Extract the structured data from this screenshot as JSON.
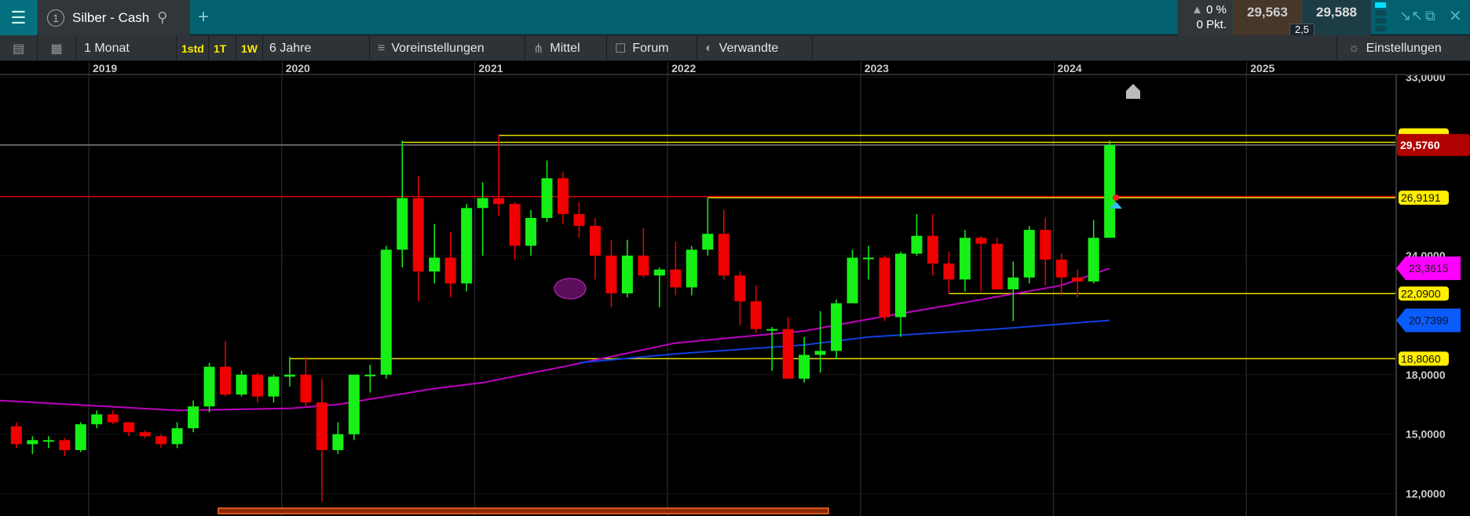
{
  "topbar": {
    "menu_icon": "hamburger-icon",
    "tab": {
      "number": "1",
      "title": "Silber - Cash",
      "search_icon": "magnifier-icon"
    },
    "add_tab_icon": "plus-icon",
    "change_percent": "0 %",
    "change_points": "0 Pkt.",
    "bid": "29,563",
    "ask": "29,588",
    "spread": "2,5",
    "colors": {
      "bar": "#02606f",
      "bid_bg": "#463728",
      "ask_bg": "#1c3d45"
    }
  },
  "toolbar": {
    "interval": "1 Monat",
    "quick": [
      "1std",
      "1T",
      "1W"
    ],
    "range": "6 Jahre",
    "presets": "Voreinstellungen",
    "indicator": "Mittel",
    "forum": "Forum",
    "related": "Verwandte",
    "settings": "Einstellungen"
  },
  "chart_data": {
    "type": "candlestick",
    "x_ticks": [
      "2019",
      "2020",
      "2021",
      "2022",
      "2023",
      "2024",
      "2025"
    ],
    "y_ticks": [
      "33,0000",
      "24,0000",
      "18,0000",
      "15,0000",
      "12,0000"
    ],
    "y_tick_values": [
      33,
      24,
      18,
      15,
      12
    ],
    "grid": true,
    "colors": {
      "up": "#16f016",
      "down": "#f00000",
      "ma_fast": "#c000c0",
      "ma_slow": "#1040e0",
      "level": "#e8e000",
      "price": "#b00000"
    },
    "candles": [
      [
        "2018-08",
        15.4,
        15.6,
        14.3,
        14.5
      ],
      [
        "2018-09",
        14.5,
        14.9,
        14.0,
        14.7
      ],
      [
        "2018-10",
        14.7,
        14.9,
        14.3,
        14.7
      ],
      [
        "2018-11",
        14.7,
        14.8,
        13.9,
        14.2
      ],
      [
        "2018-12",
        14.2,
        15.6,
        14.1,
        15.5
      ],
      [
        "2019-01",
        15.5,
        16.2,
        15.3,
        16.0
      ],
      [
        "2019-02",
        16.0,
        16.2,
        15.5,
        15.6
      ],
      [
        "2019-03",
        15.6,
        15.6,
        14.9,
        15.1
      ],
      [
        "2019-04",
        15.1,
        15.2,
        14.8,
        14.9
      ],
      [
        "2019-05",
        14.9,
        15.0,
        14.3,
        14.5
      ],
      [
        "2019-06",
        14.5,
        15.6,
        14.3,
        15.3
      ],
      [
        "2019-07",
        15.3,
        16.7,
        15.1,
        16.4
      ],
      [
        "2019-08",
        16.4,
        18.6,
        16.1,
        18.4
      ],
      [
        "2019-09",
        18.4,
        19.7,
        16.9,
        17.0
      ],
      [
        "2019-10",
        17.0,
        18.2,
        16.9,
        18.0
      ],
      [
        "2019-11",
        18.0,
        18.1,
        16.6,
        16.9
      ],
      [
        "2019-12",
        16.9,
        18.0,
        16.6,
        17.9
      ],
      [
        "2020-01",
        17.9,
        18.9,
        17.4,
        18.0
      ],
      [
        "2020-02",
        18.0,
        18.9,
        16.4,
        16.6
      ],
      [
        "2020-03",
        16.6,
        17.8,
        11.6,
        14.2
      ],
      [
        "2020-04",
        14.2,
        15.6,
        14.0,
        15.0
      ],
      [
        "2020-05",
        15.0,
        18.0,
        14.7,
        18.0
      ],
      [
        "2020-06",
        18.0,
        18.5,
        17.1,
        18.0
      ],
      [
        "2020-07",
        18.0,
        24.5,
        17.8,
        24.3
      ],
      [
        "2020-08",
        24.3,
        29.8,
        23.4,
        26.9
      ],
      [
        "2020-09",
        26.9,
        28.0,
        21.7,
        23.2
      ],
      [
        "2020-10",
        23.2,
        25.6,
        22.6,
        23.9
      ],
      [
        "2020-11",
        23.9,
        25.2,
        21.9,
        22.6
      ],
      [
        "2020-12",
        22.6,
        26.6,
        22.2,
        26.4
      ],
      [
        "2021-01",
        26.4,
        27.7,
        24.0,
        26.9
      ],
      [
        "2021-02",
        26.9,
        30.1,
        26.0,
        26.6
      ],
      [
        "2021-03",
        26.6,
        26.7,
        23.8,
        24.5
      ],
      [
        "2021-04",
        24.5,
        26.3,
        24.0,
        25.9
      ],
      [
        "2021-05",
        25.9,
        28.8,
        25.7,
        27.9
      ],
      [
        "2021-06",
        27.9,
        28.2,
        25.6,
        26.1
      ],
      [
        "2021-07",
        26.1,
        26.7,
        24.9,
        25.5
      ],
      [
        "2021-08",
        25.5,
        25.9,
        22.8,
        24.0
      ],
      [
        "2021-09",
        24.0,
        24.8,
        21.4,
        22.1
      ],
      [
        "2021-10",
        22.1,
        24.8,
        21.9,
        24.0
      ],
      [
        "2021-11",
        24.0,
        25.4,
        22.9,
        23.0
      ],
      [
        "2021-12",
        23.0,
        23.4,
        21.4,
        23.3
      ],
      [
        "2022-01",
        23.3,
        24.7,
        22.0,
        22.4
      ],
      [
        "2022-02",
        22.4,
        24.5,
        22.0,
        24.3
      ],
      [
        "2022-03",
        24.3,
        26.9,
        24.0,
        25.1
      ],
      [
        "2022-04",
        25.1,
        26.3,
        22.8,
        23.0
      ],
      [
        "2022-05",
        23.0,
        23.2,
        20.5,
        21.7
      ],
      [
        "2022-06",
        21.7,
        22.5,
        20.1,
        20.3
      ],
      [
        "2022-07",
        20.3,
        20.4,
        18.2,
        20.3
      ],
      [
        "2022-08",
        20.3,
        20.9,
        17.9,
        17.8
      ],
      [
        "2022-09",
        17.8,
        19.9,
        17.6,
        19.0
      ],
      [
        "2022-10",
        19.0,
        21.2,
        18.1,
        19.2
      ],
      [
        "2022-11",
        19.2,
        21.8,
        18.8,
        21.6
      ],
      [
        "2022-12",
        21.6,
        24.3,
        21.6,
        23.9
      ],
      [
        "2023-01",
        23.9,
        24.5,
        22.8,
        23.9
      ],
      [
        "2023-02",
        23.9,
        24.0,
        20.7,
        20.9
      ],
      [
        "2023-03",
        20.9,
        24.2,
        19.9,
        24.1
      ],
      [
        "2023-04",
        24.1,
        26.1,
        24.0,
        25.0
      ],
      [
        "2023-05",
        25.0,
        26.1,
        23.0,
        23.6
      ],
      [
        "2023-06",
        23.6,
        24.2,
        22.1,
        22.8
      ],
      [
        "2023-07",
        22.8,
        25.3,
        22.2,
        24.9
      ],
      [
        "2023-08",
        24.9,
        25.0,
        22.2,
        24.6
      ],
      [
        "2023-09",
        24.6,
        24.9,
        22.3,
        22.3
      ],
      [
        "2023-10",
        22.3,
        23.7,
        20.7,
        22.9
      ],
      [
        "2023-11",
        22.9,
        25.5,
        22.6,
        25.3
      ],
      [
        "2023-12",
        25.3,
        25.9,
        22.5,
        23.8
      ],
      [
        "2024-01",
        23.8,
        24.1,
        22.0,
        22.9
      ],
      [
        "2024-02",
        22.9,
        23.3,
        21.9,
        22.7
      ],
      [
        "2024-03",
        22.7,
        25.8,
        22.6,
        24.9
      ],
      [
        "2024-04",
        24.9,
        29.8,
        26.0,
        29.576
      ]
    ],
    "ma_fast": [
      [
        "2018-08",
        16.7
      ],
      [
        "2019-06",
        16.2
      ],
      [
        "2020-01",
        16.3
      ],
      [
        "2020-04",
        16.5
      ],
      [
        "2020-10",
        17.3
      ],
      [
        "2021-01",
        17.6
      ],
      [
        "2021-06",
        18.4
      ],
      [
        "2022-01",
        19.6
      ],
      [
        "2022-09",
        20.2
      ],
      [
        "2023-01",
        20.8
      ],
      [
        "2023-06",
        21.5
      ],
      [
        "2024-01",
        22.5
      ],
      [
        "2024-04",
        23.3615
      ]
    ],
    "ma_slow": [
      [
        "2021-07",
        18.6
      ],
      [
        "2022-01",
        19.05
      ],
      [
        "2022-09",
        19.5
      ],
      [
        "2023-01",
        19.9
      ],
      [
        "2023-09",
        20.3
      ],
      [
        "2024-04",
        20.7399
      ]
    ],
    "levels": [
      {
        "value": 30.06,
        "from": "2021-02",
        "color": "#e8e000",
        "label": ""
      },
      {
        "value": 29.71,
        "from": "2020-08",
        "color": "#e8e000"
      },
      {
        "value": 29.576,
        "from": "2018-08",
        "color": "#808080"
      },
      {
        "value": 26.98,
        "from": "2018-08",
        "color": "#e00000"
      },
      {
        "value": 26.9191,
        "from": "2022-03",
        "color": "#e8e000",
        "label": "26,9191"
      },
      {
        "value": 22.09,
        "from": "2023-06",
        "color": "#e8e000",
        "label": "22,0900"
      },
      {
        "value": 18.806,
        "from": "2020-01",
        "color": "#e8e000",
        "label": "18,8060"
      }
    ],
    "price_label": "29,5760",
    "ma_fast_label": "23,3615",
    "ma_slow_label": "20,7399"
  }
}
